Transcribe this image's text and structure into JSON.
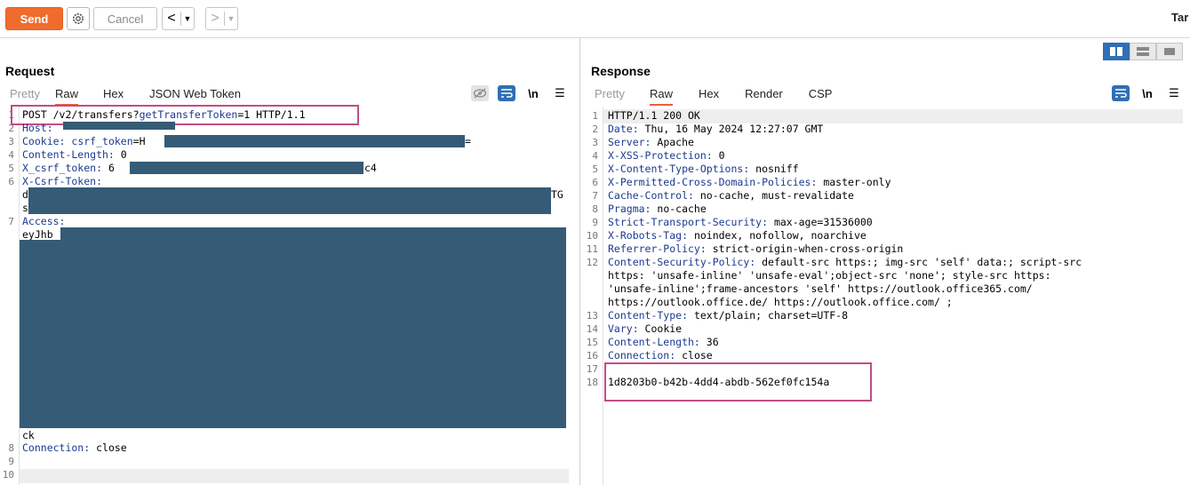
{
  "toolbar": {
    "send_label": "Send",
    "cancel_label": "Cancel",
    "back_icon": "chevron-left-icon",
    "forward_icon": "chevron-right-icon",
    "target_label": "Tar"
  },
  "request": {
    "title": "Request",
    "tabs": [
      "Pretty",
      "Raw",
      "Hex",
      "JSON Web Token"
    ],
    "active_tab": "Raw",
    "line_numbers": [
      "1",
      "2",
      "3",
      "4",
      "5",
      "6",
      "7",
      "8",
      "9",
      "10"
    ],
    "lines": {
      "l1_method": "POST /v2/transfers?",
      "l1_param": "getTransferToken",
      "l1_rest": "=1 HTTP/1.1",
      "l2_name": "Host:",
      "l3_name": "Cookie:",
      "l3_cookie": "csrf_token",
      "l3_value": "=H",
      "l3_tail": "=",
      "l4_name": "Content-Length:",
      "l4_value": "0",
      "l5_name": "X_csrf_token:",
      "l5_value": "6",
      "l5_tail": "c4",
      "l6_name": "X-Csrf-Token:",
      "l6_v1": "d",
      "l6_v1_tail": "TG",
      "l6_v2": "s",
      "l7_name": "Access:",
      "l7_value": "eyJhb",
      "l7_tail": "ck",
      "l8_name": "Connection:",
      "l8_value": "close"
    }
  },
  "response": {
    "title": "Response",
    "tabs": [
      "Pretty",
      "Raw",
      "Hex",
      "Render",
      "CSP"
    ],
    "active_tab": "Raw",
    "line_numbers": [
      "1",
      "2",
      "3",
      "4",
      "5",
      "6",
      "7",
      "8",
      "9",
      "10",
      "11",
      "12",
      "",
      "",
      "",
      "13",
      "14",
      "15",
      "16",
      "17",
      "18"
    ],
    "headers": [
      {
        "name": "HTTP/1.1 200 OK",
        "value": ""
      },
      {
        "name": "Date:",
        "value": " Thu, 16 May 2024 12:27:07 GMT"
      },
      {
        "name": "Server:",
        "value": " Apache"
      },
      {
        "name": "X-XSS-Protection:",
        "value": " 0"
      },
      {
        "name": "X-Content-Type-Options:",
        "value": " nosniff"
      },
      {
        "name": "X-Permitted-Cross-Domain-Policies:",
        "value": " master-only"
      },
      {
        "name": "Cache-Control:",
        "value": " no-cache, must-revalidate"
      },
      {
        "name": "Pragma:",
        "value": " no-cache"
      },
      {
        "name": "Strict-Transport-Security:",
        "value": " max-age=31536000"
      },
      {
        "name": "X-Robots-Tag:",
        "value": " noindex, nofollow, noarchive"
      },
      {
        "name": "Referrer-Policy:",
        "value": " strict-origin-when-cross-origin"
      },
      {
        "name": "Content-Security-Policy:",
        "value": " default-src https:; img-src 'self' data:; script-src"
      },
      {
        "name": "",
        "value": "https: 'unsafe-inline' 'unsafe-eval';object-src 'none'; style-src https:"
      },
      {
        "name": "",
        "value": "'unsafe-inline';frame-ancestors 'self' https://outlook.office365.com/"
      },
      {
        "name": "",
        "value": "https://outlook.office.de/ https://outlook.office.com/ ;"
      },
      {
        "name": "Content-Type:",
        "value": " text/plain; charset=UTF-8"
      },
      {
        "name": "Vary:",
        "value": " Cookie"
      },
      {
        "name": "Content-Length:",
        "value": " 36"
      },
      {
        "name": "Connection:",
        "value": " close"
      },
      {
        "name": "",
        "value": ""
      },
      {
        "name": "",
        "value": "1d8203b0-b42b-4dd4-abdb-562ef0fc154a"
      }
    ]
  },
  "colors": {
    "accent": "#ef6c2e",
    "header_name": "#1b3a8f",
    "redaction": "#355b76",
    "highlight_box": "#c24d86",
    "active_icon": "#2f6fb5"
  }
}
